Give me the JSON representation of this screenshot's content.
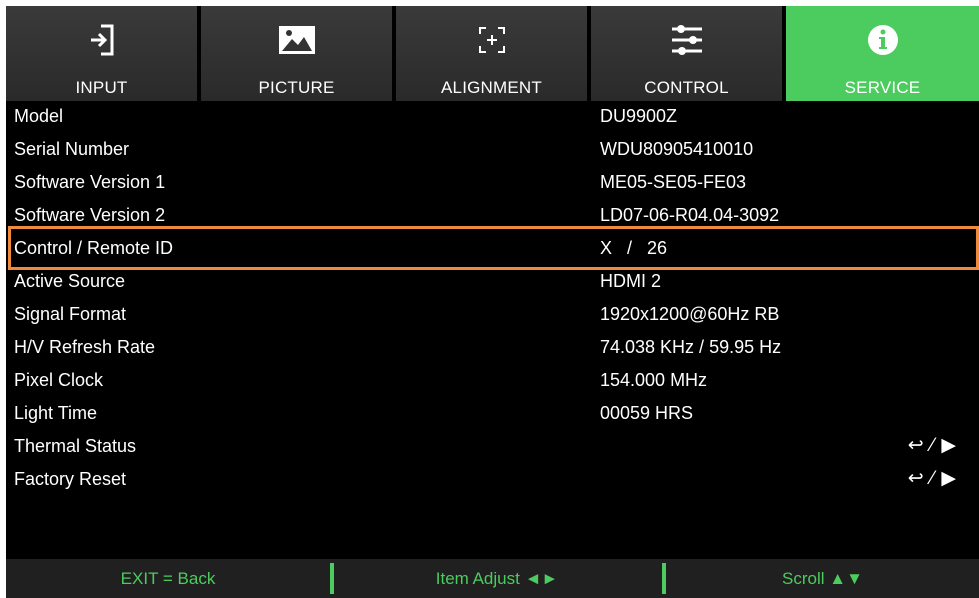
{
  "tabs": [
    {
      "label": "INPUT",
      "icon": "input-icon"
    },
    {
      "label": "PICTURE",
      "icon": "picture-icon"
    },
    {
      "label": "ALIGNMENT",
      "icon": "alignment-icon"
    },
    {
      "label": "CONTROL",
      "icon": "control-sliders-icon"
    },
    {
      "label": "SERVICE",
      "icon": "info-icon",
      "active": true
    }
  ],
  "rows": [
    {
      "label": "Model",
      "value": "DU9900Z"
    },
    {
      "label": "Serial Number",
      "value": "WDU80905410010"
    },
    {
      "label": "Software Version 1",
      "value": "ME05-SE05-FE03"
    },
    {
      "label": "Software Version 2",
      "value": "LD07-06-R04.04-3092"
    },
    {
      "label": "Control / Remote ID",
      "value": "X   /   26",
      "selected": true
    },
    {
      "label": "Active Source",
      "value": "HDMI 2"
    },
    {
      "label": "Signal Format",
      "value": "1920x1200@60Hz RB"
    },
    {
      "label": "H/V Refresh Rate",
      "value": "74.038 KHz / 59.95 Hz"
    },
    {
      "label": "Pixel Clock",
      "value": "154.000 MHz"
    },
    {
      "label": "Light Time",
      "value": "00059 HRS"
    },
    {
      "label": "Thermal Status",
      "action": "↩ ⁄ ▶"
    },
    {
      "label": "Factory Reset",
      "action": "↩ ⁄ ▶"
    }
  ],
  "footer": {
    "back": "EXIT = Back",
    "adjust": "Item Adjust ◄►",
    "scroll": "Scroll ▲▼"
  },
  "colors": {
    "accent": "#4ccb5e",
    "selection": "#ee8a3c",
    "tab_bg": "#333333",
    "background": "#000000"
  }
}
